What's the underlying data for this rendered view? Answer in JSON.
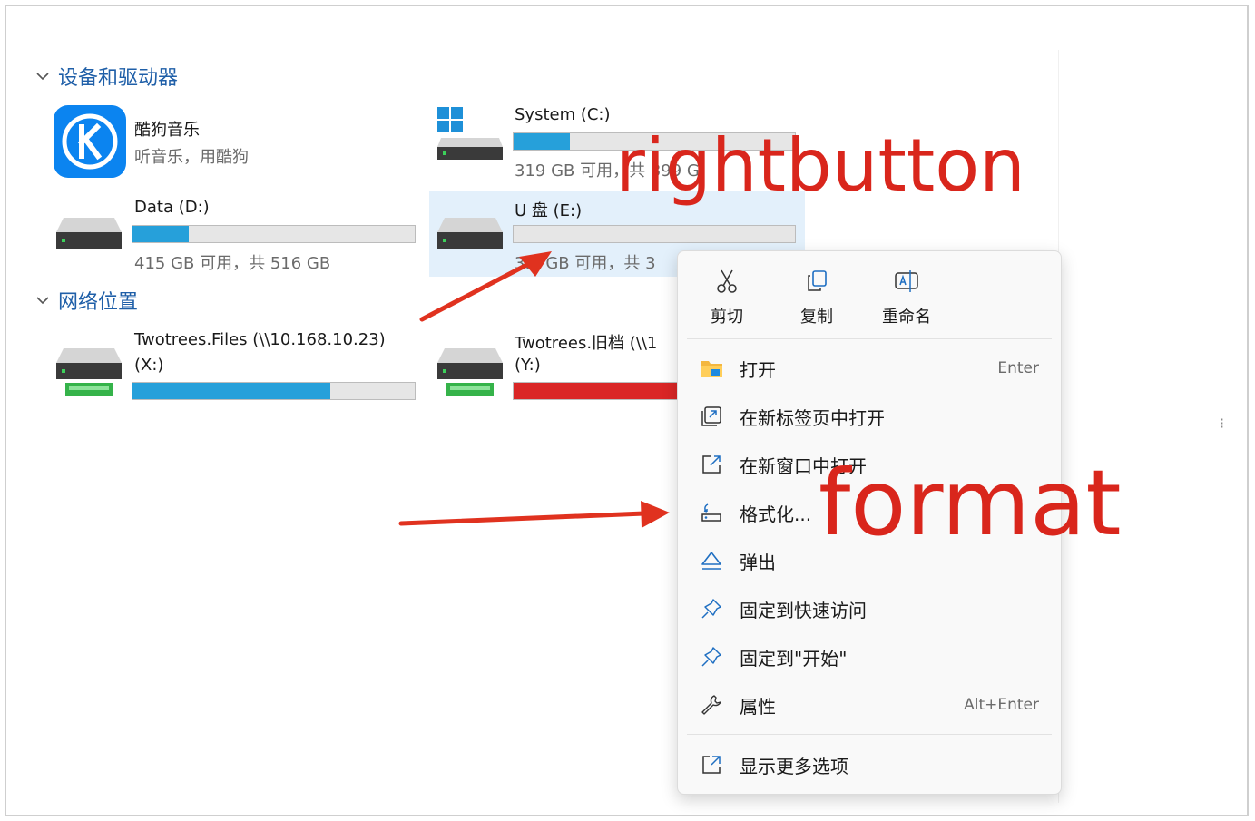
{
  "sections": {
    "devices": "设备和驱动器",
    "network": "网络位置"
  },
  "drives": {
    "kugou": {
      "name": "酷狗音乐",
      "sub": "听音乐，用酷狗"
    },
    "system": {
      "name": "System (C:)",
      "sub": "319 GB 可用，共 399 G",
      "used": 0.2
    },
    "data": {
      "name": "Data (D:)",
      "sub": "415 GB 可用，共 516 GB",
      "used": 0.2
    },
    "udisk": {
      "name": "U 盘 (E:)",
      "sub": "3.5 GB 可用，共 3",
      "used": 0.0
    },
    "twotrees": {
      "name": "Twotrees.Files (\\\\10.168.10.23)",
      "letter": "(X:)",
      "used": 0.7
    },
    "twotrees_old": {
      "name": "Twotrees.旧档 (\\\\1",
      "letter": "(Y:)",
      "used": 1.0
    }
  },
  "context_menu": {
    "quick_actions": [
      {
        "label": "剪切",
        "icon": "scissors-icon"
      },
      {
        "label": "复制",
        "icon": "copy-icon"
      },
      {
        "label": "重命名",
        "icon": "rename-icon"
      }
    ],
    "items": [
      {
        "label": "打开",
        "shortcut": "Enter",
        "icon": "folder-icon"
      },
      {
        "label": "在新标签页中打开",
        "shortcut": "",
        "icon": "new-tab-icon"
      },
      {
        "label": "在新窗口中打开",
        "shortcut": "",
        "icon": "new-window-icon"
      },
      {
        "label": "格式化...",
        "shortcut": "",
        "icon": "format-icon"
      },
      {
        "label": "弹出",
        "shortcut": "",
        "icon": "eject-icon"
      },
      {
        "label": "固定到快速访问",
        "shortcut": "",
        "icon": "pin-icon"
      },
      {
        "label": "固定到\"开始\"",
        "shortcut": "",
        "icon": "pin-start-icon"
      },
      {
        "label": "属性",
        "shortcut": "Alt+Enter",
        "icon": "wrench-icon"
      }
    ],
    "more": {
      "label": "显示更多选项",
      "icon": "more-options-icon"
    }
  },
  "annotations": {
    "rightbutton": "rightbutton",
    "format": "format"
  },
  "colors": {
    "accent": "#26a0da",
    "annotation": "#d9261c",
    "section": "#1f5fa8"
  }
}
